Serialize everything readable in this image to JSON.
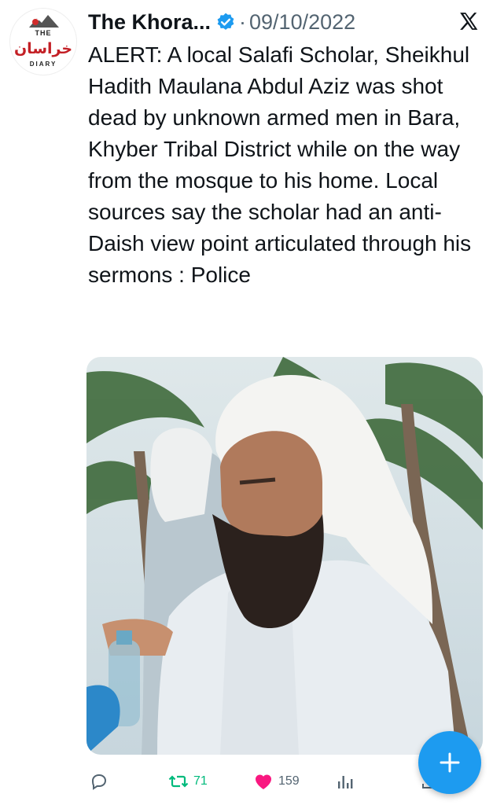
{
  "tweet": {
    "author": "The Khora...",
    "separator": "·",
    "date": "09/10/2022",
    "text": "ALERT: A local Salafi Scholar, Sheikhul Hadith Maulana Abdul Aziz was shot dead by unknown armed men in Bara, Khyber Tribal District while on the way from the mosque to his home. Local sources say the scholar had an anti-Daish view point articulated through his sermons : Police"
  },
  "avatar_logo": {
    "the": "THE",
    "urdu": "خراسان",
    "diary": "DIARY"
  },
  "stats": {
    "retweets": "71",
    "likes": "159"
  },
  "icons": {
    "reply": "reply-icon",
    "retweet": "retweet-icon",
    "like": "heart-icon",
    "views": "views-icon",
    "share": "share-icon",
    "verified": "verified-badge-icon",
    "brand": "x-logo-icon",
    "compose": "plus-icon"
  },
  "colors": {
    "accent": "#1d9bf0",
    "retweet": "#00ba7c",
    "like": "#f91880",
    "muted": "#536471",
    "verified": "#1d9bf0"
  }
}
